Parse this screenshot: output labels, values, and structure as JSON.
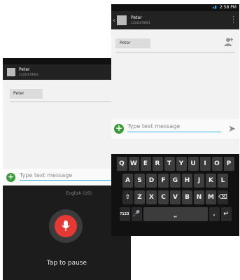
{
  "back_screen": {
    "contact_name": "Peter",
    "contact_number": "12345678901",
    "recipient_chip": "Peter",
    "compose_placeholder": "Type text message",
    "language_label": "English (US)",
    "pause_label": "Tap to pause",
    "icons": {
      "add": "plus-circle-icon",
      "mic": "microphone-icon"
    }
  },
  "front_screen": {
    "status_time": "2:58 PM",
    "contact_name": "Peter",
    "contact_number": "12345678901",
    "recipient_chip": "Peter",
    "compose_placeholder": "Type text message",
    "icons": {
      "back": "chevron-left-icon",
      "menu": "overflow-menu-icon",
      "add_contact": "add-person-icon",
      "add": "plus-circle-icon",
      "send": "send-icon"
    }
  },
  "keyboard": {
    "row1": [
      "Q",
      "W",
      "E",
      "R",
      "T",
      "Y",
      "U",
      "I",
      "O",
      "P"
    ],
    "row2": [
      "A",
      "S",
      "D",
      "F",
      "G",
      "H",
      "J",
      "K",
      "L"
    ],
    "row3": [
      "Z",
      "X",
      "C",
      "V",
      "B",
      "N",
      "M"
    ],
    "shift": "⇧",
    "backspace": "⌫",
    "numbers": "?123",
    "mic": "🎤",
    "space": "⎵",
    "period": ".",
    "enter": "↵"
  },
  "colors": {
    "accent": "#33b5e5",
    "green": "#3a9a3a",
    "mic_red": "#e53935",
    "dark": "#1c1c1c"
  }
}
